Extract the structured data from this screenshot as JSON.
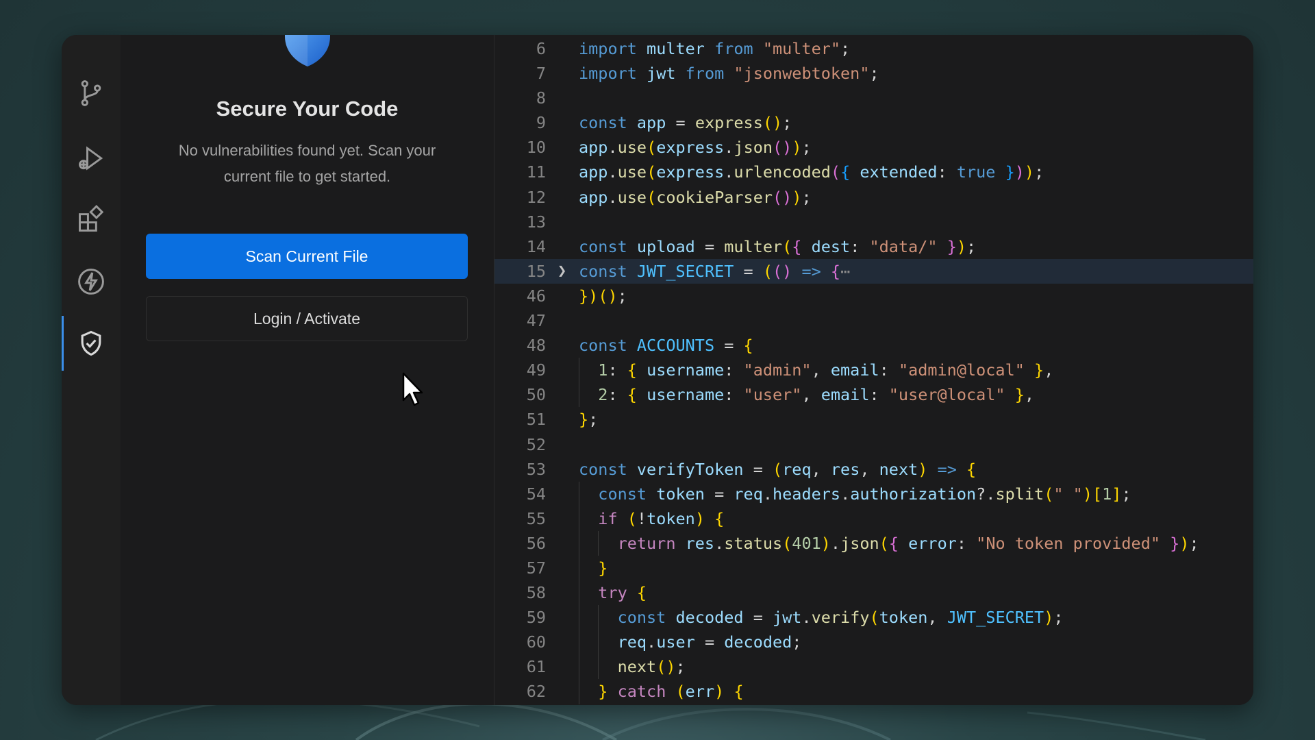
{
  "window": {
    "background": "#1b1b1c",
    "accent": "#0a6fe0"
  },
  "activity_bar": {
    "items": [
      {
        "icon": "source-control-icon",
        "active": false
      },
      {
        "icon": "run-debug-icon",
        "active": false
      },
      {
        "icon": "extensions-icon",
        "active": false
      },
      {
        "icon": "lightning-icon",
        "active": false
      },
      {
        "icon": "shield-check-icon",
        "active": true
      }
    ]
  },
  "panel": {
    "logo_icon": "shield-icon",
    "title": "Secure Your Code",
    "description": "No vulnerabilities found yet. Scan your current file to get started.",
    "scan_button": "Scan Current File",
    "login_button": "Login / Activate"
  },
  "editor": {
    "highlighted_line": "15",
    "lines": [
      {
        "num": "6",
        "text": "import multer from \"multer\";"
      },
      {
        "num": "7",
        "text": "import jwt from \"jsonwebtoken\";"
      },
      {
        "num": "8",
        "text": ""
      },
      {
        "num": "9",
        "text": "const app = express();"
      },
      {
        "num": "10",
        "text": "app.use(express.json());"
      },
      {
        "num": "11",
        "text": "app.use(express.urlencoded({ extended: true }));"
      },
      {
        "num": "12",
        "text": "app.use(cookieParser());"
      },
      {
        "num": "13",
        "text": ""
      },
      {
        "num": "14",
        "text": "const upload = multer({ dest: \"data/\" });"
      },
      {
        "num": "15",
        "text": "const JWT_SECRET = (() => {⋯"
      },
      {
        "num": "46",
        "text": "})();"
      },
      {
        "num": "47",
        "text": ""
      },
      {
        "num": "48",
        "text": "const ACCOUNTS = {"
      },
      {
        "num": "49",
        "text": "  1: { username: \"admin\", email: \"admin@local\" },"
      },
      {
        "num": "50",
        "text": "  2: { username: \"user\", email: \"user@local\" },"
      },
      {
        "num": "51",
        "text": "};"
      },
      {
        "num": "52",
        "text": ""
      },
      {
        "num": "53",
        "text": "const verifyToken = (req, res, next) => {"
      },
      {
        "num": "54",
        "text": "  const token = req.headers.authorization?.split(\" \")[1];"
      },
      {
        "num": "55",
        "text": "  if (!token) {"
      },
      {
        "num": "56",
        "text": "    return res.status(401).json({ error: \"No token provided\" });"
      },
      {
        "num": "57",
        "text": "  }"
      },
      {
        "num": "58",
        "text": "  try {"
      },
      {
        "num": "59",
        "text": "    const decoded = jwt.verify(token, JWT_SECRET);"
      },
      {
        "num": "60",
        "text": "    req.user = decoded;"
      },
      {
        "num": "61",
        "text": "    next();"
      },
      {
        "num": "62",
        "text": "  } catch (err) {"
      }
    ]
  }
}
